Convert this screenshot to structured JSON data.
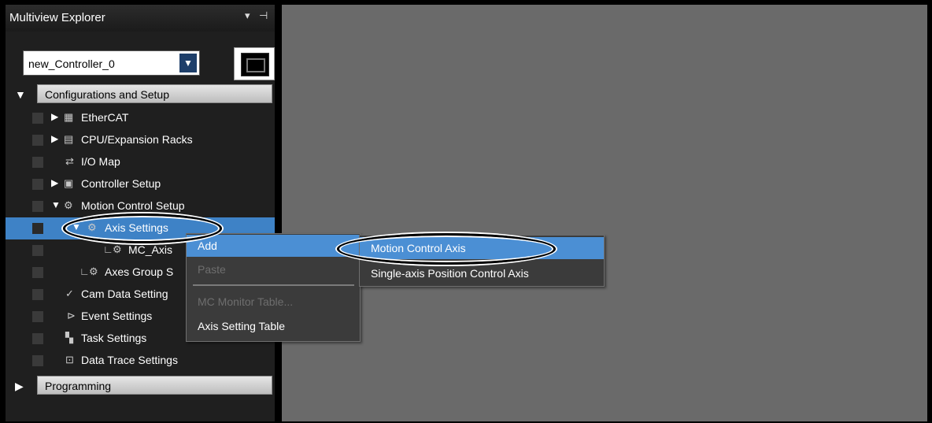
{
  "panel": {
    "title": "Multiview Explorer",
    "pin_left": "▾",
    "pin_right": "⊣"
  },
  "controller_select": {
    "value": "new_Controller_0"
  },
  "tree": {
    "group1_label": "Configurations and Setup",
    "items": [
      {
        "label": "EtherCAT",
        "icon": "ethercat-icon",
        "expander": "▶"
      },
      {
        "label": "CPU/Expansion Racks",
        "icon": "rack-icon",
        "expander": "▶"
      },
      {
        "label": "I/O Map",
        "icon": "io-map-icon",
        "expander": ""
      },
      {
        "label": "Controller Setup",
        "icon": "controller-setup-icon",
        "expander": "▶"
      },
      {
        "label": "Motion Control Setup",
        "icon": "gear-icon",
        "expander": "▼"
      },
      {
        "label": "Axis Settings",
        "icon": "gear-icon",
        "expander": "▼"
      },
      {
        "label": "MC_Axis",
        "icon": "gear-icon",
        "expander": ""
      },
      {
        "label": "Axes Group S",
        "icon": "axes-group-icon",
        "expander": ""
      },
      {
        "label": "Cam Data Setting",
        "icon": "cam-icon",
        "expander": ""
      },
      {
        "label": "Event Settings",
        "icon": "event-flag-icon",
        "expander": ""
      },
      {
        "label": "Task Settings",
        "icon": "task-icon",
        "expander": ""
      },
      {
        "label": "Data Trace Settings",
        "icon": "data-trace-icon",
        "expander": ""
      }
    ],
    "group2_label": "Programming"
  },
  "context_menu": {
    "items": [
      {
        "label": "Add",
        "enabled": true
      },
      {
        "label": "Paste",
        "enabled": false
      },
      {
        "label": "MC Monitor Table...",
        "enabled": false
      },
      {
        "label": "Axis Setting Table",
        "enabled": true
      }
    ]
  },
  "submenu": {
    "items": [
      {
        "label": "Motion Control Axis"
      },
      {
        "label": "Single-axis Position Control Axis"
      }
    ]
  }
}
